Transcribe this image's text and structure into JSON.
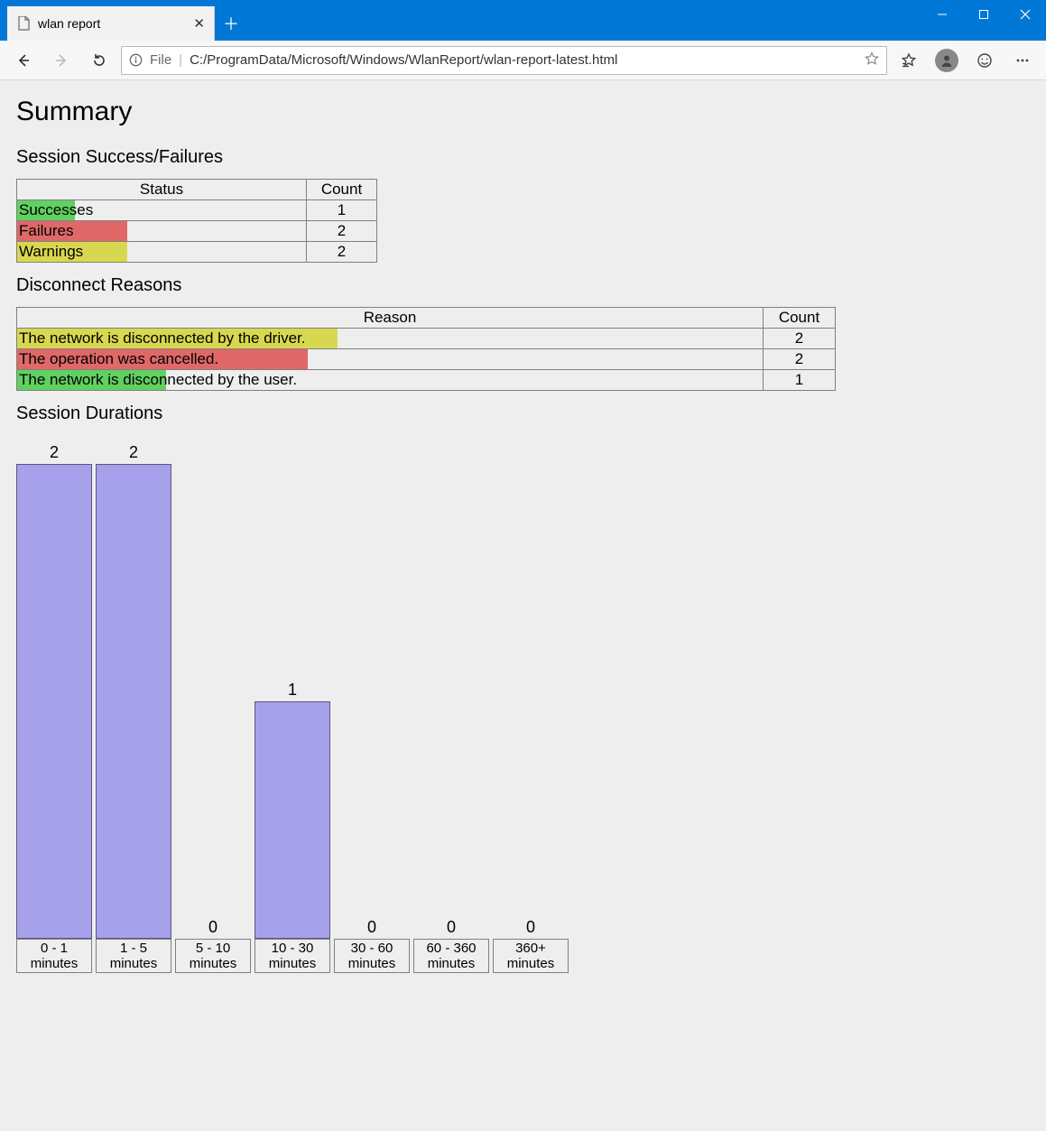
{
  "window": {
    "tab_title": "wlan report",
    "address_label": "File",
    "url": "C:/ProgramData/Microsoft/Windows/WlanReport/wlan-report-latest.html"
  },
  "page": {
    "title": "Summary",
    "sections": {
      "statuses": {
        "heading": "Session Success/Failures",
        "cols": {
          "status": "Status",
          "count": "Count"
        },
        "rows": [
          {
            "label": "Successes",
            "count": 1,
            "color": "green",
            "fill_pct": 20
          },
          {
            "label": "Failures",
            "count": 2,
            "color": "red",
            "fill_pct": 38
          },
          {
            "label": "Warnings",
            "count": 2,
            "color": "yellow",
            "fill_pct": 38
          }
        ]
      },
      "reasons": {
        "heading": "Disconnect Reasons",
        "cols": {
          "reason": "Reason",
          "count": "Count"
        },
        "rows": [
          {
            "label": "The network is disconnected by the driver.",
            "count": 2,
            "color": "yellow",
            "fill_pct": 43
          },
          {
            "label": "The operation was cancelled.",
            "count": 2,
            "color": "red",
            "fill_pct": 39
          },
          {
            "label": "The network is disconnected by the user.",
            "count": 1,
            "color": "green",
            "fill_pct": 20
          }
        ]
      },
      "durations": {
        "heading": "Session Durations"
      }
    }
  },
  "chart_data": {
    "type": "bar",
    "categories": [
      "0 - 1",
      "1 - 5",
      "5 - 10",
      "10 - 30",
      "30 - 60",
      "60 - 360",
      "360+"
    ],
    "values": [
      2,
      2,
      0,
      1,
      0,
      0,
      0
    ],
    "unit_label": "minutes",
    "title": "Session Durations",
    "xlabel": "",
    "ylabel": "",
    "ylim": [
      0,
      2
    ]
  }
}
